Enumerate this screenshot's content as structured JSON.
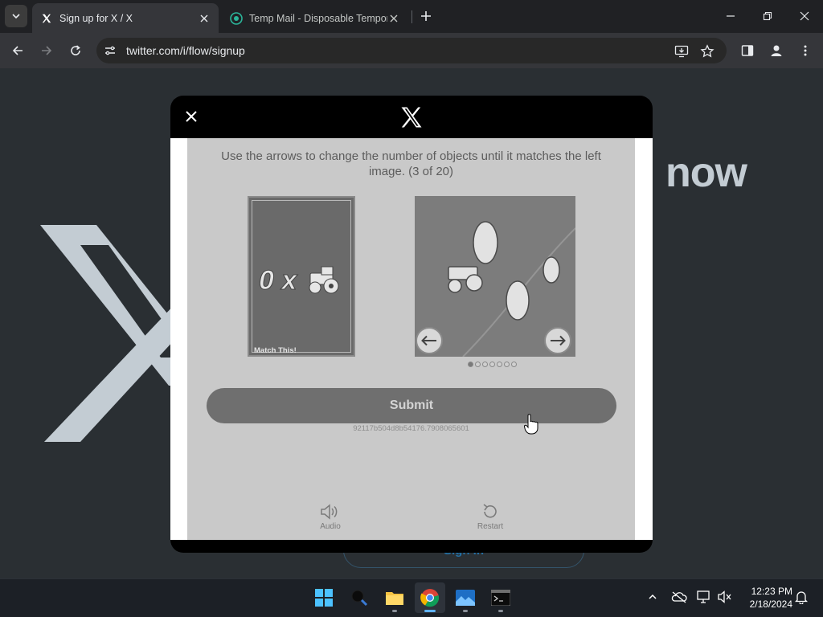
{
  "browser": {
    "tabs": [
      {
        "title": "Sign up for X / X",
        "active": true
      },
      {
        "title": "Temp Mail - Disposable Temporary",
        "active": false
      }
    ],
    "url": "twitter.com/i/flow/signup"
  },
  "page_bg": {
    "heading_fragment": "now",
    "signin_label": "Sign in"
  },
  "captcha": {
    "instruction": "Use the arrows to change the number of objects until it matches the left image. (3 of 20)",
    "match_label": "Match This!",
    "match_glyph_text": "0 x",
    "dots_total": 7,
    "dots_active_index": 0,
    "submit_label": "Submit",
    "session_id": "92117b504d8b54176.7908065601",
    "audio_label": "Audio",
    "restart_label": "Restart"
  },
  "taskbar": {
    "time": "12:23 PM",
    "date": "2/18/2024"
  },
  "colors": {
    "chrome_bg": "#202124",
    "toolbar_bg": "#35363a",
    "page_bg": "#2a2f33",
    "captcha_bg": "#c9c9c9",
    "submit_bg": "#6f6f6f",
    "taskbar_bg": "#1c2026"
  }
}
